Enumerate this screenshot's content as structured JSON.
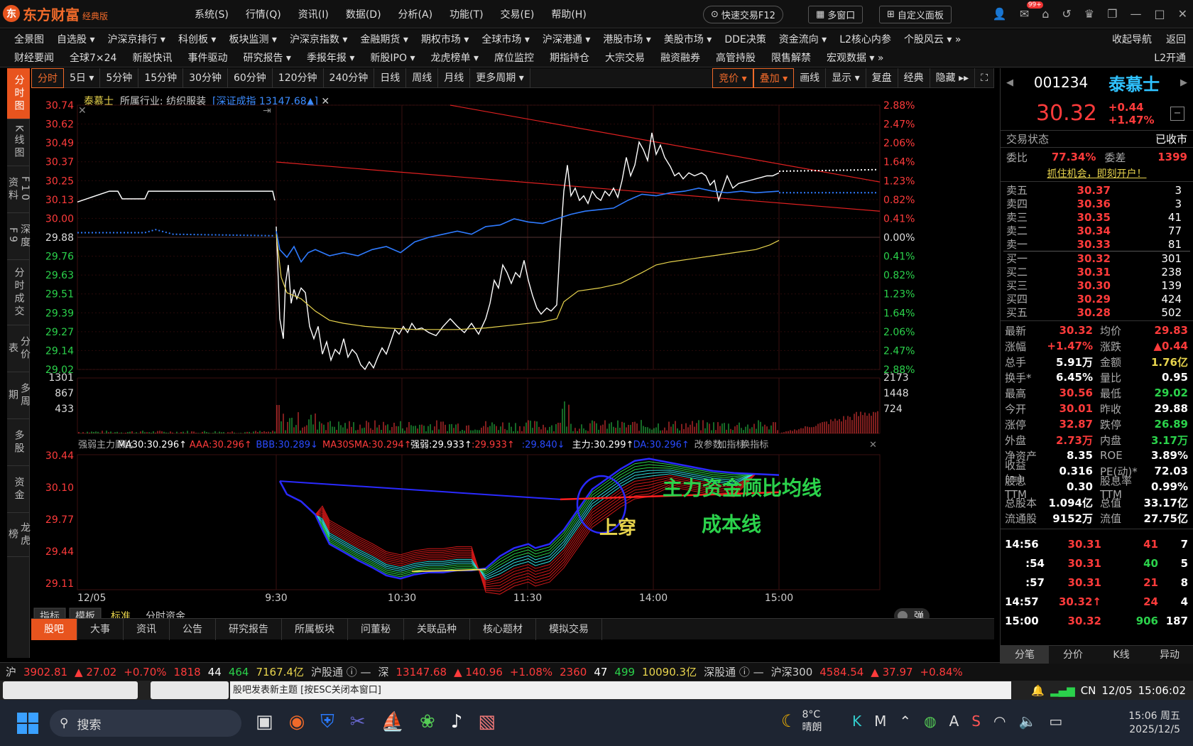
{
  "app": {
    "logo_text": "东方财富",
    "edition": "经典版"
  },
  "menu": [
    "系统(S)",
    "行情(Q)",
    "资讯(I)",
    "数据(D)",
    "分析(A)",
    "功能(T)",
    "交易(E)",
    "帮助(H)"
  ],
  "top_buttons": {
    "quick_trade": "快速交易F12",
    "multi_window": "多窗口",
    "custom_panel": "自定义面板",
    "badge": "99+"
  },
  "nav1": [
    "全景图",
    "自选股 ▾",
    "沪深京排行 ▾",
    "科创板 ▾",
    "板块监测 ▾",
    "沪深京指数 ▾",
    "金融期货 ▾",
    "期权市场 ▾",
    "全球市场 ▾",
    "沪深港通 ▾",
    "港股市场 ▾",
    "美股市场 ▾",
    "DDE决策",
    "资金流向 ▾",
    "L2核心内参",
    "个股风云 ▾ »"
  ],
  "nav1_right": [
    "收起导航",
    "返回"
  ],
  "nav2": [
    "财经要闻",
    "全球7×24",
    "新股快讯",
    "事件驱动",
    "研究报告 ▾",
    "季报年报 ▾",
    "新股IPO ▾",
    "龙虎榜单 ▾",
    "席位监控",
    "期指持仓",
    "大宗交易",
    "融资融券",
    "高管持股",
    "限售解禁",
    "宏观数据 ▾ »"
  ],
  "nav2_right": "L2开通",
  "leftbar": [
    {
      "label": "分时图",
      "active": true
    },
    {
      "label": "K线图"
    },
    {
      "label": "F10资料"
    },
    {
      "label": "深度F9"
    },
    {
      "label": "分时成交"
    },
    {
      "label": "分价表"
    },
    {
      "label": "多周期"
    },
    {
      "label": "多股"
    },
    {
      "label": "资金"
    },
    {
      "label": "龙虎榜"
    }
  ],
  "periods": [
    "分时",
    "5日 ▾",
    "5分钟",
    "15分钟",
    "30分钟",
    "60分钟",
    "120分钟",
    "240分钟",
    "日线",
    "周线",
    "月线",
    "更多周期 ▾"
  ],
  "period_right": [
    "竞价 ▾",
    "叠加 ▾",
    "画线",
    "显示 ▾",
    "复盘",
    "经典",
    "隐藏 ▸▸"
  ],
  "info": {
    "name": "泰慕士",
    "industry": "所属行业: 纺织服装",
    "index": "[深证成指 13147.68▲]"
  },
  "price_axis": [
    "30.74",
    "30.62",
    "30.49",
    "30.37",
    "30.25",
    "30.13",
    "30.00",
    "29.88",
    "29.76",
    "29.63",
    "29.51",
    "29.39",
    "29.27",
    "29.14",
    "29.02"
  ],
  "pct_axis": [
    "2.88%",
    "2.47%",
    "2.06%",
    "1.64%",
    "1.23%",
    "0.82%",
    "0.41%",
    "0.00%",
    "0.41%",
    "0.82%",
    "1.23%",
    "1.64%",
    "2.06%",
    "2.47%",
    "2.88%"
  ],
  "vol_axis_left": [
    "1301",
    "867",
    "433"
  ],
  "vol_axis_right": [
    "2173",
    "1448",
    "724"
  ],
  "ind_axis": [
    "30.44",
    "30.10",
    "29.77",
    "29.44",
    "29.11"
  ],
  "time_axis": [
    "12/05",
    "9:30",
    "10:30",
    "11:30",
    "14:00",
    "15:00"
  ],
  "indicator_header": [
    {
      "t": "强弱主力顾比",
      "c": "#aaa"
    },
    {
      "t": "MA30:30.296↑",
      "c": "#fff"
    },
    {
      "t": "AAA:30.296↑",
      "c": "#ff3b3b"
    },
    {
      "t": "BBB:30.289↓",
      "c": "#2a4bff"
    },
    {
      "t": "MA30SMA:30.294↑",
      "c": "#ff3b3b"
    },
    {
      "t": "强弱:29.933↑",
      "c": "#fff"
    },
    {
      "t": ":29.933↑",
      "c": "#ff3b3b"
    },
    {
      "t": ":29.840↓",
      "c": "#2a4bff"
    },
    {
      "t": "主力:30.299↑",
      "c": "#fff"
    },
    {
      "t": "DA:30.296↑",
      "c": "#2a4bff"
    },
    {
      "t": "改参数",
      "c": "#aaa"
    },
    {
      "t": "加指标",
      "c": "#aaa"
    },
    {
      "t": "换指标",
      "c": "#aaa"
    }
  ],
  "annotations": {
    "main_fund": "主力资金顾比均线",
    "cost_line": "成本线",
    "cross_up": "上穿"
  },
  "chart_tabs": [
    "指标",
    "模板",
    "标准",
    "分时资金"
  ],
  "bottom_tabs": [
    "股吧",
    "大事",
    "资讯",
    "公告",
    "研究报告",
    "所属板块",
    "问董秘",
    "关联品种",
    "核心题材",
    "模拟交易"
  ],
  "pop_btn": "弹",
  "ticker": {
    "sh_label": "沪",
    "sh": "3902.81",
    "sh_chg": "▲ 27.02",
    "sh_pct": "+0.70%",
    "sh_up": "1818",
    "sh_flat": "44",
    "sh_down": "464",
    "sh_amt": "7167.4亿",
    "hgt": "沪股通 ⓘ —",
    "sz_label": "深",
    "sz": "13147.68",
    "sz_chg": "▲ 140.96",
    "sz_pct": "+1.08%",
    "sz_up": "2360",
    "sz_flat": "47",
    "sz_down": "499",
    "sz_amt": "10090.3亿",
    "sgt": "深股通 ⓘ —",
    "hs300_label": "沪深300",
    "hs300": "4584.54",
    "hs300_chg": "▲ 37.97",
    "hs300_pct": "+0.84%"
  },
  "bar2": {
    "post_hint": "股吧发表新主题 [按ESC关闭本窗口]",
    "cn": "CN",
    "date": "12/05",
    "time": "15:06:02"
  },
  "stock": {
    "code": "001234",
    "name": "泰慕士",
    "price": "30.32",
    "chg": "+0.44",
    "pct": "+1.47%",
    "state_label": "交易状态",
    "state": "已收市",
    "wb_label": "委比",
    "wb": "77.34%",
    "wc_label": "委差",
    "wc": "1399",
    "promo": "抓住机会，即刻开户！"
  },
  "asks": [
    {
      "l": "卖五",
      "p": "30.37",
      "v": "3"
    },
    {
      "l": "卖四",
      "p": "30.36",
      "v": "3"
    },
    {
      "l": "卖三",
      "p": "30.35",
      "v": "41"
    },
    {
      "l": "卖二",
      "p": "30.34",
      "v": "77"
    },
    {
      "l": "卖一",
      "p": "30.33",
      "v": "81"
    }
  ],
  "bids": [
    {
      "l": "买一",
      "p": "30.32",
      "v": "301"
    },
    {
      "l": "买二",
      "p": "30.31",
      "v": "238"
    },
    {
      "l": "买三",
      "p": "30.30",
      "v": "139"
    },
    {
      "l": "买四",
      "p": "30.29",
      "v": "424"
    },
    {
      "l": "买五",
      "p": "30.28",
      "v": "502"
    }
  ],
  "stats": [
    [
      "最新",
      "30.32",
      "r",
      "均价",
      "29.83",
      "r"
    ],
    [
      "涨幅",
      "+1.47%",
      "r",
      "涨跌",
      "▲0.44",
      "r"
    ],
    [
      "总手",
      "5.91万",
      "w",
      "金额",
      "1.76亿",
      "y"
    ],
    [
      "换手*",
      "6.45%",
      "w",
      "量比",
      "0.95",
      "w"
    ],
    [
      "最高",
      "30.56",
      "r",
      "最低",
      "29.02",
      "g"
    ],
    [
      "今开",
      "30.01",
      "r",
      "昨收",
      "29.88",
      "w"
    ],
    [
      "涨停",
      "32.87",
      "r",
      "跌停",
      "26.89",
      "g"
    ],
    [
      "外盘",
      "2.73万",
      "r",
      "内盘",
      "3.17万",
      "g"
    ],
    [
      "净资产",
      "8.35",
      "w",
      "ROE",
      "3.89%",
      "w"
    ],
    [
      "收益(≡)",
      "0.316",
      "w",
      "PE(动)*",
      "72.03",
      "w"
    ],
    [
      "股息TTM",
      "0.30",
      "w",
      "股息率TTM",
      "0.99%",
      "w"
    ],
    [
      "总股本",
      "1.094亿",
      "w",
      "总值",
      "33.17亿",
      "w"
    ],
    [
      "流通股",
      "9152万",
      "w",
      "流值",
      "27.75亿",
      "w"
    ]
  ],
  "ticks": [
    {
      "t": "14:56",
      "p": "30.31",
      "v": "41",
      "n": "7"
    },
    {
      "t": ":54",
      "p": "30.31",
      "v": "40",
      "n": "5"
    },
    {
      "t": ":57",
      "p": "30.31",
      "v": "21",
      "n": "8"
    },
    {
      "t": "14:57",
      "p": "30.32↑",
      "v": "24",
      "n": "4"
    },
    {
      "t": "15:00",
      "p": "30.32",
      "v": "906",
      "n": "187"
    }
  ],
  "right_tabs": [
    "分笔",
    "分价",
    "K线",
    "异动"
  ],
  "taskbar": {
    "search": "搜索",
    "weather_temp": "8°C",
    "weather": "晴朗",
    "time": "15:06 周五",
    "date": "2025/12/5"
  }
}
